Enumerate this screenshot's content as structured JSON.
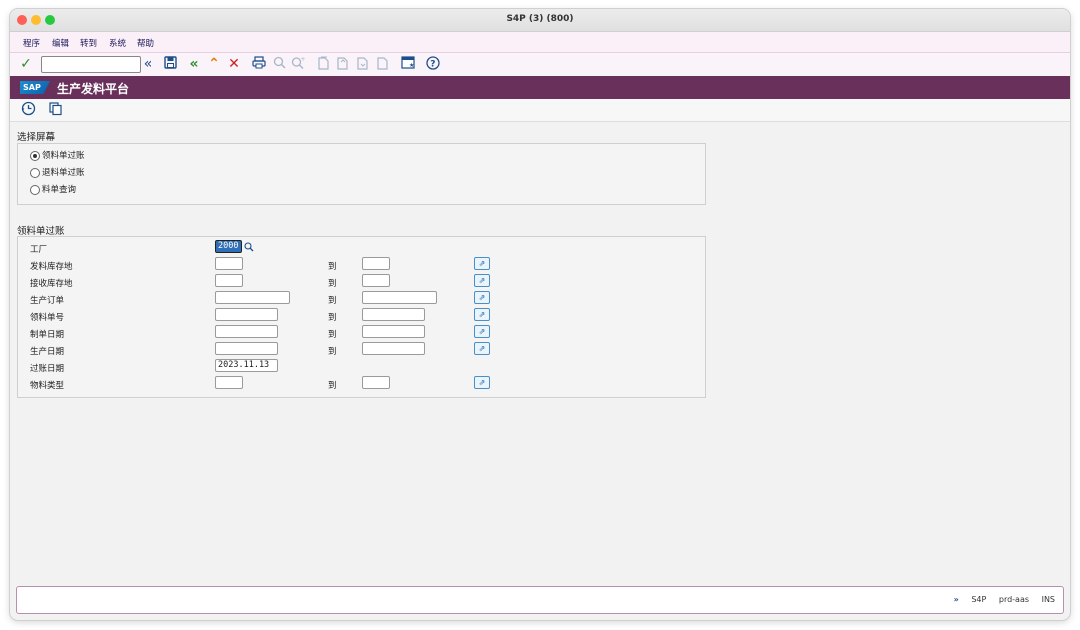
{
  "window": {
    "title": "S4P (3) (800)"
  },
  "menu": [
    "程序",
    "编辑",
    "转到",
    "系统",
    "帮助"
  ],
  "toolbar": {
    "command_value": ""
  },
  "app": {
    "logo_text": "SAP",
    "title": "生产发料平台"
  },
  "selection": {
    "title": "选择屏幕",
    "options": [
      {
        "label": "领料单过账",
        "selected": true
      },
      {
        "label": "退料单过账",
        "selected": false
      },
      {
        "label": "料单查询",
        "selected": false
      }
    ]
  },
  "posting": {
    "title": "领料单过账",
    "to_label": "到",
    "rows": [
      {
        "label": "工厂",
        "from": "2000",
        "range": false
      },
      {
        "label": "发料库存地",
        "from": "",
        "range": true
      },
      {
        "label": "接收库存地",
        "from": "",
        "range": true
      },
      {
        "label": "生产订单",
        "from": "",
        "range": true
      },
      {
        "label": "领料单号",
        "from": "",
        "range": true
      },
      {
        "label": "制单日期",
        "from": "",
        "range": true
      },
      {
        "label": "生产日期",
        "from": "",
        "range": true
      },
      {
        "label": "过账日期",
        "from": "2023.11.13",
        "range": false
      },
      {
        "label": "物料类型",
        "from": "",
        "range": true
      }
    ]
  },
  "status": {
    "system": "S4P",
    "server": "prd-aas",
    "mode": "INS"
  }
}
